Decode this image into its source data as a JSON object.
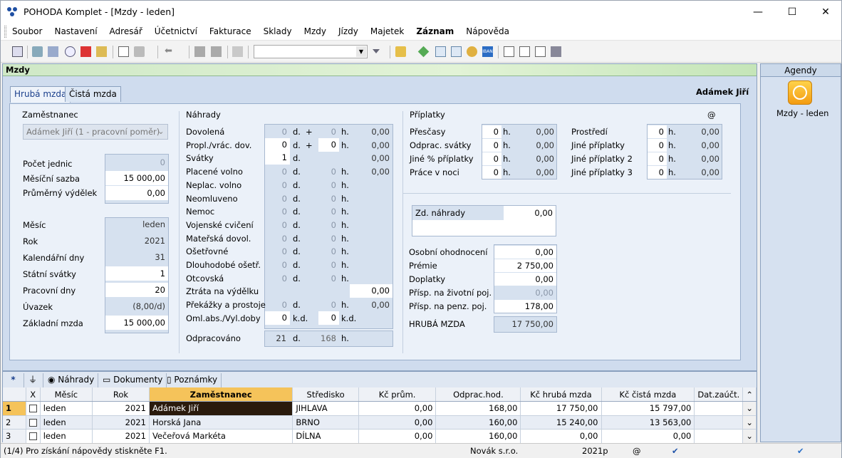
{
  "window": {
    "title": "POHODA Komplet - [Mzdy - leden]",
    "min": "—",
    "max": "☐",
    "close": "✕"
  },
  "menu": [
    "Soubor",
    "Nastavení",
    "Adresář",
    "Účetnictví",
    "Fakturace",
    "Sklady",
    "Mzdy",
    "Jízdy",
    "Majetek",
    "Záznam",
    "Nápověda"
  ],
  "section_title": "Mzdy",
  "tabs": {
    "gross": "Hrubá mzda",
    "net": "Čistá mzda"
  },
  "employee_name": "Adámek Jiří",
  "zam": {
    "title": "Zaměstnanec",
    "select": "Adámek Jiří (1 - pracovní poměr)",
    "rows": [
      {
        "label": "Počet jednic",
        "value": "0"
      },
      {
        "label": "Měsíční sazba",
        "value": "15 000,00"
      },
      {
        "label": "Průměrný výdělek",
        "value": "0,00"
      }
    ],
    "rows2": [
      {
        "label": "Měsíc",
        "value": "leden"
      },
      {
        "label": "Rok",
        "value": "2021"
      },
      {
        "label": "Kalendářní dny",
        "value": "31"
      },
      {
        "label": "Státní svátky",
        "value": "1"
      },
      {
        "label": "Pracovní dny",
        "value": "20"
      },
      {
        "label": "Úvazek",
        "value": "(8,00/d)"
      },
      {
        "label": "Základní mzda",
        "value": "15 000,00"
      }
    ]
  },
  "nahrady": {
    "title": "Náhrady",
    "rows": [
      {
        "label": "Dovolená",
        "d": "0",
        "u1": "d.",
        "plus": "+",
        "h": "0",
        "u2": "h.",
        "amt": "0,00"
      },
      {
        "label": "Propl./vrác. dov.",
        "d": "0",
        "u1": "d.",
        "plus": "+",
        "h": "0",
        "u2": "h.",
        "amt": "0,00"
      },
      {
        "label": "Svátky",
        "d": "1",
        "u1": "d.",
        "plus": "",
        "h": "",
        "u2": "",
        "amt": "0,00"
      },
      {
        "label": "Placené volno",
        "d": "0",
        "u1": "d.",
        "plus": "",
        "h": "0",
        "u2": "h.",
        "amt": "0,00"
      },
      {
        "label": "Neplac. volno",
        "d": "0",
        "u1": "d.",
        "plus": "",
        "h": "0",
        "u2": "h.",
        "amt": ""
      },
      {
        "label": "Neomluveno",
        "d": "0",
        "u1": "d.",
        "plus": "",
        "h": "0",
        "u2": "h.",
        "amt": ""
      },
      {
        "label": "Nemoc",
        "d": "0",
        "u1": "d.",
        "plus": "",
        "h": "0",
        "u2": "h.",
        "amt": ""
      },
      {
        "label": "Vojenské cvičení",
        "d": "0",
        "u1": "d.",
        "plus": "",
        "h": "0",
        "u2": "h.",
        "amt": ""
      },
      {
        "label": "Mateřská dovol.",
        "d": "0",
        "u1": "d.",
        "plus": "",
        "h": "0",
        "u2": "h.",
        "amt": ""
      },
      {
        "label": "Ošetřovné",
        "d": "0",
        "u1": "d.",
        "plus": "",
        "h": "0",
        "u2": "h.",
        "amt": ""
      },
      {
        "label": "Dlouhodobé ošetř.",
        "d": "0",
        "u1": "d.",
        "plus": "",
        "h": "0",
        "u2": "h.",
        "amt": ""
      },
      {
        "label": "Otcovská",
        "d": "0",
        "u1": "d.",
        "plus": "",
        "h": "0",
        "u2": "h.",
        "amt": ""
      },
      {
        "label": "Ztráta na výdělku",
        "d": "",
        "u1": "",
        "plus": "",
        "h": "",
        "u2": "",
        "amt": "0,00"
      },
      {
        "label": "Překážky a prostoje",
        "d": "0",
        "u1": "d.",
        "plus": "",
        "h": "0",
        "u2": "h.",
        "amt": "0,00"
      },
      {
        "label": "Oml.abs./Vyl.doby",
        "d": "0",
        "u1": "k.d.",
        "plus": "",
        "h": "0",
        "u2": "k.d.",
        "amt": ""
      }
    ],
    "odprac": {
      "label": "Odpracováno",
      "d": "21",
      "u1": "d.",
      "h": "168",
      "u2": "h."
    }
  },
  "priplatky": {
    "title": "Příplatky",
    "at": "@",
    "left": [
      {
        "label": "Přesčasy",
        "h": "0",
        "u": "h.",
        "amt": "0,00"
      },
      {
        "label": "Odprac. svátky",
        "h": "0",
        "u": "h.",
        "amt": "0,00"
      },
      {
        "label": "Jiné % příplatky",
        "h": "0",
        "u": "h.",
        "amt": "0,00"
      },
      {
        "label": "Práce v noci",
        "h": "0",
        "u": "h.",
        "amt": "0,00"
      }
    ],
    "right": [
      {
        "label": "Prostředí",
        "h": "0",
        "u": "h.",
        "amt": "0,00"
      },
      {
        "label": "Jiné příplatky",
        "h": "0",
        "u": "h.",
        "amt": "0,00"
      },
      {
        "label": "Jiné příplatky 2",
        "h": "0",
        "u": "h.",
        "amt": "0,00"
      },
      {
        "label": "Jiné příplatky 3",
        "h": "0",
        "u": "h.",
        "amt": "0,00"
      }
    ]
  },
  "zd_nahrady": {
    "label": "Zd. náhrady",
    "value": "0,00"
  },
  "other": [
    {
      "label": "Osobní ohodnocení",
      "value": "0,00"
    },
    {
      "label": "Prémie",
      "value": "2 750,00"
    },
    {
      "label": "Doplatky",
      "value": "0,00"
    },
    {
      "label": "Přísp. na životní poj.",
      "value": "0,00"
    },
    {
      "label": "Přísp. na penz. poj.",
      "value": "178,00"
    }
  ],
  "hruba": {
    "label": "HRUBÁ MZDA",
    "value": "17 750,00"
  },
  "agenda": {
    "title": "Agendy",
    "item": "Mzdy - leden"
  },
  "bottom_tabs": {
    "star": "*",
    "nahrady": "Náhrady",
    "dokumenty": "Dokumenty",
    "poznamky": "Poznámky"
  },
  "table": {
    "headers": [
      "X",
      "Měsíc",
      "Rok",
      "Zaměstnanec",
      "Středisko",
      "Kč prům.",
      "Odprac.hod.",
      "Kč hrubá mzda",
      "Kč čistá mzda",
      "Dat.zaúčt."
    ],
    "rows": [
      {
        "n": "1",
        "mesic": "leden",
        "rok": "2021",
        "zam": "Adámek Jiří",
        "str": "JIHLAVA",
        "prum": "0,00",
        "hod": "168,00",
        "hruba": "17 750,00",
        "cista": "15 797,00",
        "dat": ""
      },
      {
        "n": "2",
        "mesic": "leden",
        "rok": "2021",
        "zam": "Horská Jana",
        "str": "BRNO",
        "prum": "0,00",
        "hod": "160,00",
        "hruba": "15 240,00",
        "cista": "13 563,00",
        "dat": ""
      },
      {
        "n": "3",
        "mesic": "leden",
        "rok": "2021",
        "zam": "Večeřová Markéta",
        "str": "DÍLNA",
        "prum": "0,00",
        "hod": "160,00",
        "hruba": "0,00",
        "cista": "0,00",
        "dat": ""
      }
    ]
  },
  "status": {
    "help": "(1/4) Pro získání nápovědy stiskněte F1.",
    "company": "Novák s.r.o.",
    "year": "2021p",
    "at": "@"
  }
}
